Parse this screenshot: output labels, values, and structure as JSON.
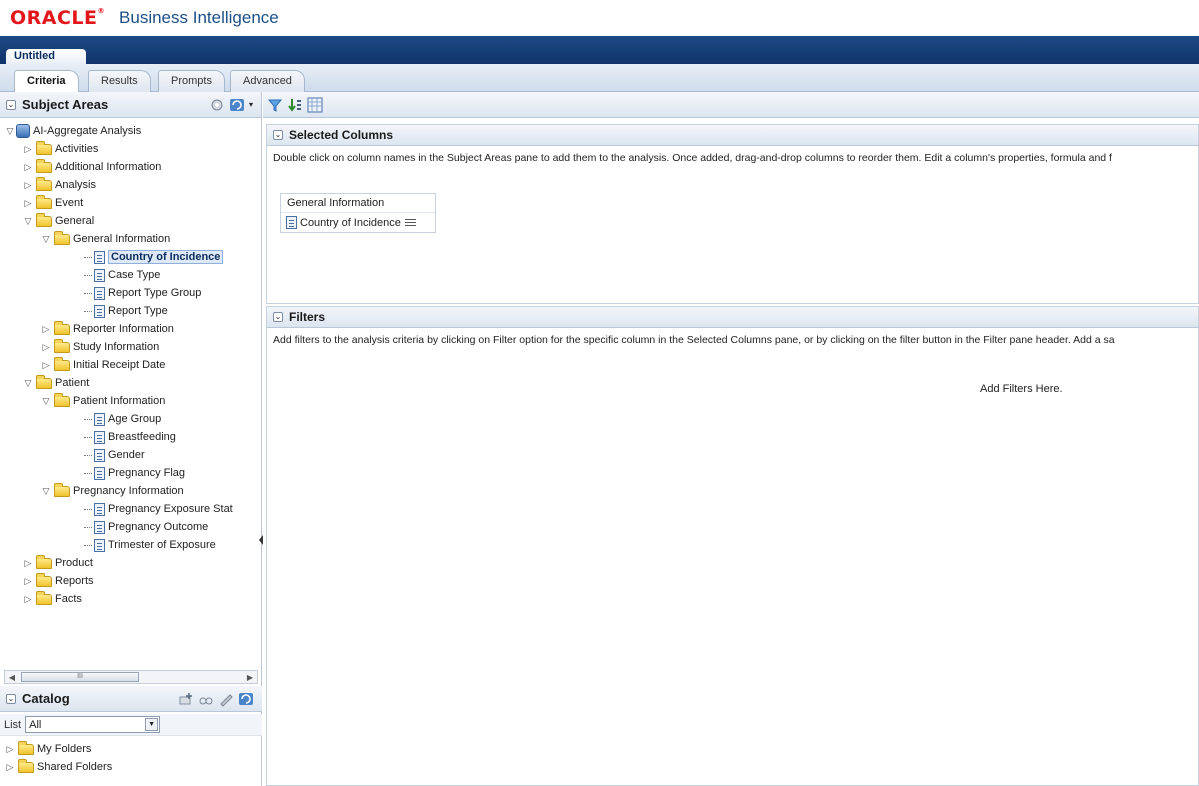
{
  "brand": {
    "oracle": "ORACLE",
    "product": "Business Intelligence"
  },
  "document_tab": "Untitled",
  "tabs": [
    {
      "label": "Criteria",
      "active": true
    },
    {
      "label": "Results",
      "active": false
    },
    {
      "label": "Prompts",
      "active": false
    },
    {
      "label": "Advanced",
      "active": false
    }
  ],
  "subject_areas": {
    "title": "Subject Areas",
    "root": "AI-Aggregate Analysis",
    "items": [
      "Activities",
      "Additional Information",
      "Analysis",
      "Event",
      "General",
      "General Information",
      "Country of Incidence",
      "Case Type",
      "Report Type Group",
      "Report Type",
      "Reporter Information",
      "Study Information",
      "Initial Receipt Date",
      "Patient",
      "Patient Information",
      "Age Group",
      "Breastfeeding",
      "Gender",
      "Pregnancy Flag",
      "Pregnancy Information",
      "Pregnancy Exposure Stat",
      "Pregnancy Outcome",
      "Trimester of Exposure",
      "Product",
      "Reports",
      "Facts"
    ]
  },
  "catalog": {
    "title": "Catalog",
    "list_label": "List",
    "list_value": "All",
    "folders": [
      "My Folders",
      "Shared Folders"
    ]
  },
  "selected_columns": {
    "title": "Selected Columns",
    "description": "Double click on column names in the Subject Areas pane to add them to the analysis. Once added, drag-and-drop columns to reorder them. Edit a column's properties, formula and f",
    "folder": "General Information",
    "column": "Country of Incidence"
  },
  "filters": {
    "title": "Filters",
    "description": "Add filters to the analysis criteria by clicking on Filter option for the specific column in the Selected Columns pane, or by clicking on the filter button in the Filter pane header. Add a sa",
    "placeholder": "Add Filters Here."
  },
  "colors": {
    "brand_red": "#e3161c",
    "title_bar": "#1d4a86",
    "selection": "#dfe9f6"
  }
}
